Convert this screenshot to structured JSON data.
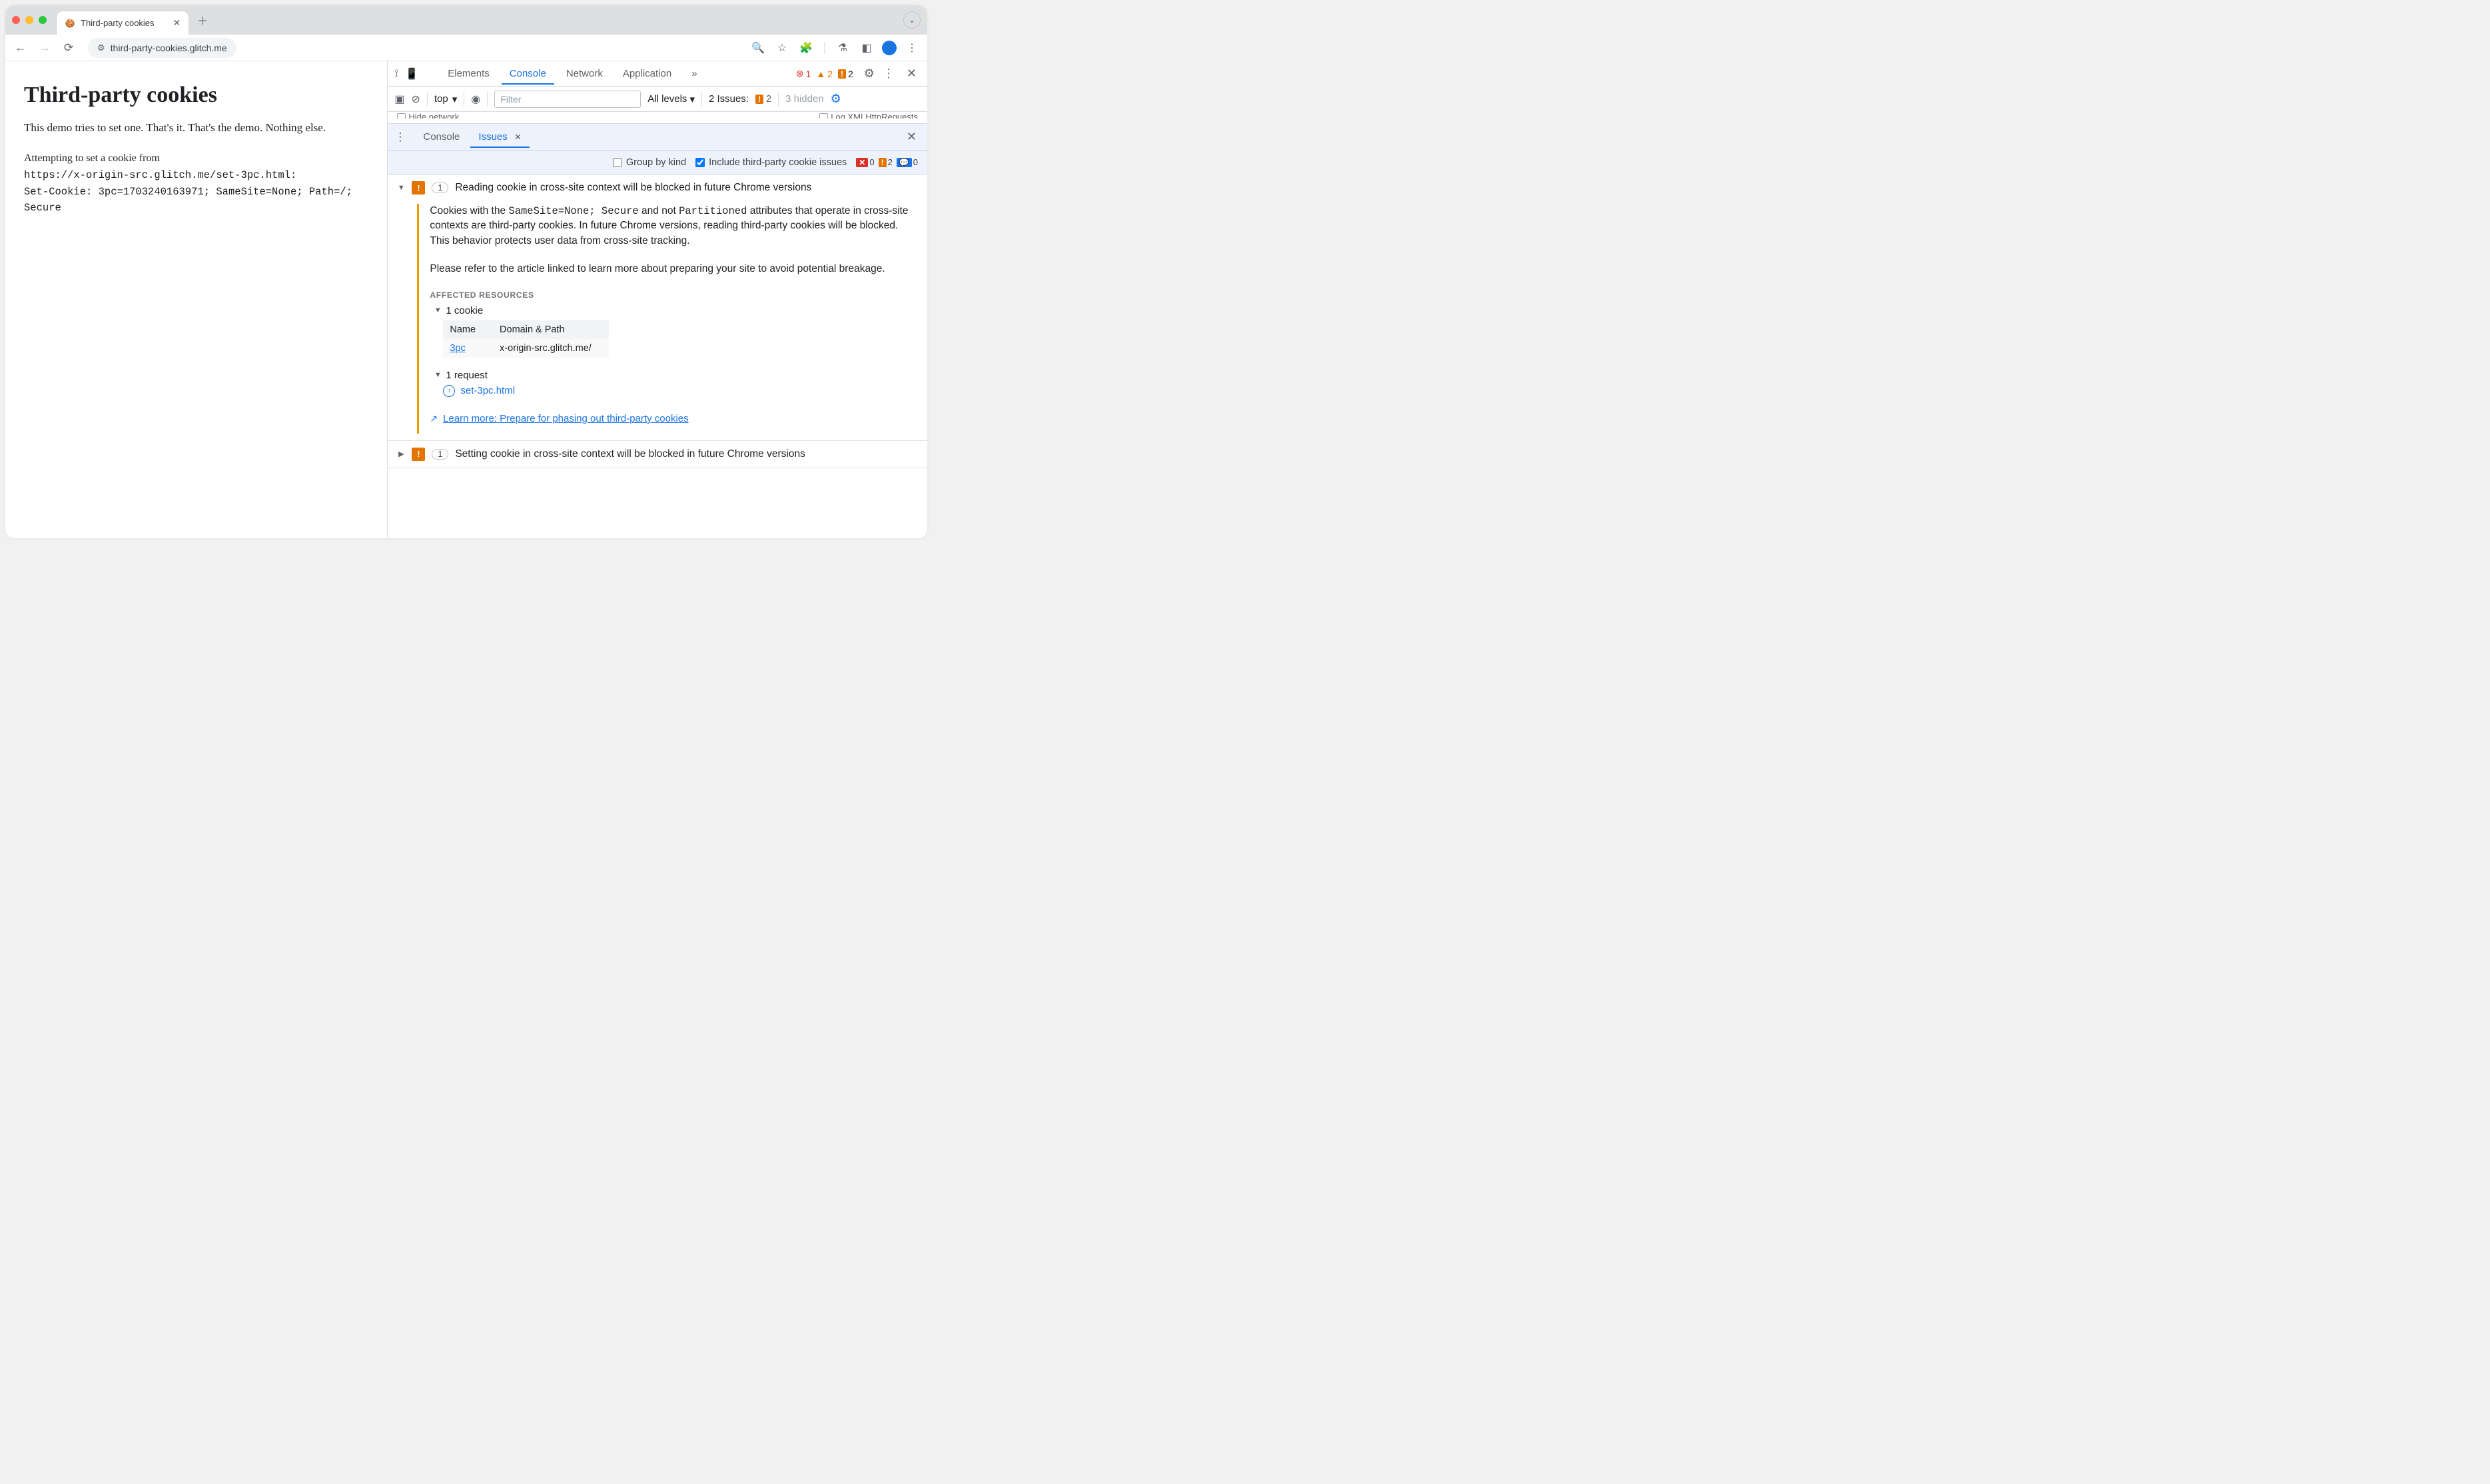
{
  "browser": {
    "tab_title": "Third-party cookies",
    "url": "third-party-cookies.glitch.me"
  },
  "page": {
    "h1": "Third-party cookies",
    "intro": "This demo tries to set one. That's it. That's the demo. Nothing else.",
    "attempt_line1": "Attempting to set a cookie from",
    "attempt_url": "https://x-origin-src.glitch.me/set-3pc.html",
    "attempt_colon": ":",
    "set_cookie_line": "Set-Cookie: 3pc=1703240163971; SameSite=None; Path=/; Secure"
  },
  "devtools": {
    "tabs": [
      "Elements",
      "Console",
      "Network",
      "Application"
    ],
    "active_tab": "Console",
    "more_tabs_glyph": "»",
    "status": {
      "errors": "1",
      "warnings": "2",
      "warn_fill": "2"
    },
    "toolbar": {
      "context": "top",
      "filter_placeholder": "Filter",
      "level_label": "All levels",
      "issues_label": "2 Issues:",
      "issue_badge": "2",
      "hidden_label": "3 hidden"
    },
    "clipped": {
      "left": "Hide network",
      "right": "Log XMLHttpRequests"
    }
  },
  "drawer": {
    "tabs": [
      "Console",
      "Issues"
    ],
    "active": "Issues"
  },
  "issues_toolbar": {
    "group_label": "Group by kind",
    "include_label": "Include third-party cookie issues",
    "include_checked": true,
    "counts": {
      "err": "0",
      "warn": "2",
      "info": "0"
    }
  },
  "issues": [
    {
      "expanded": true,
      "count": "1",
      "title": "Reading cookie in cross-site context will be blocked in future Chrome versions",
      "para1_a": "Cookies with the ",
      "para1_code1": "SameSite=None; Secure",
      "para1_b": " and not ",
      "para1_code2": "Partitioned",
      "para1_c": " attributes that operate in cross-site contexts are third-party cookies. In future Chrome versions, reading third-party cookies will be blocked. This behavior protects user data from cross-site tracking.",
      "para2": "Please refer to the article linked to learn more about preparing your site to avoid potential breakage.",
      "aff_head": "AFFECTED RESOURCES",
      "cookie_toggle": "1 cookie",
      "table": {
        "col_name": "Name",
        "col_domain": "Domain & Path",
        "row_name": "3pc",
        "row_domain": "x-origin-src.glitch.me/"
      },
      "request_toggle": "1 request",
      "request_link": "set-3pc.html",
      "learn_more": "Learn more: Prepare for phasing out third-party cookies"
    },
    {
      "expanded": false,
      "count": "1",
      "title": "Setting cookie in cross-site context will be blocked in future Chrome versions"
    }
  ]
}
